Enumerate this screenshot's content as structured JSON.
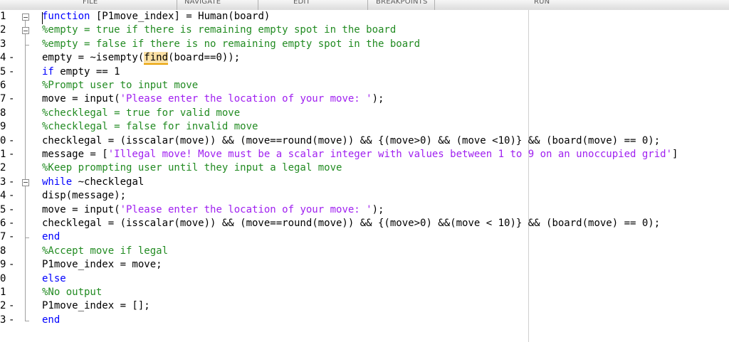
{
  "toolbar": {
    "sections": [
      "FILE",
      "NAVIGATE",
      "EDIT",
      "BREAKPOINTS",
      "RUN"
    ]
  },
  "editor": {
    "lines": [
      {
        "num": "1",
        "mark": "",
        "segs": [
          {
            "t": "function",
            "c": "kw"
          },
          {
            "t": " [P1move_index] = Human(board)",
            "c": ""
          }
        ]
      },
      {
        "num": "2",
        "mark": "",
        "segs": [
          {
            "t": "%empty = true if there is remaining empty spot in the board",
            "c": "cm"
          }
        ]
      },
      {
        "num": "3",
        "mark": "",
        "segs": [
          {
            "t": "%empty = false if there is no remaining empty spot in the board",
            "c": "cm"
          }
        ]
      },
      {
        "num": "4",
        "mark": "-",
        "segs": [
          {
            "t": "empty = ~isempty(",
            "c": ""
          },
          {
            "t": "find",
            "c": "hl"
          },
          {
            "t": "(board==0));",
            "c": ""
          }
        ]
      },
      {
        "num": "5",
        "mark": "-",
        "segs": [
          {
            "t": "if",
            "c": "kw"
          },
          {
            "t": " empty == 1",
            "c": ""
          }
        ]
      },
      {
        "num": "6",
        "mark": "",
        "segs": [
          {
            "t": "%Prompt user to input move",
            "c": "cm"
          }
        ]
      },
      {
        "num": "7",
        "mark": "-",
        "segs": [
          {
            "t": "move = input(",
            "c": ""
          },
          {
            "t": "'Please enter the location of your move: '",
            "c": "str"
          },
          {
            "t": ");",
            "c": ""
          }
        ]
      },
      {
        "num": "8",
        "mark": "",
        "segs": [
          {
            "t": "%checklegal = true for valid move",
            "c": "cm"
          }
        ]
      },
      {
        "num": "9",
        "mark": "",
        "segs": [
          {
            "t": "%checklegal = false for invalid move",
            "c": "cm"
          }
        ]
      },
      {
        "num": "0",
        "mark": "-",
        "segs": [
          {
            "t": "checklegal = (isscalar(move)) && (move==round(move)) && {(move>0) && (move <10)} && (board(move) == 0);",
            "c": ""
          }
        ]
      },
      {
        "num": "1",
        "mark": "-",
        "segs": [
          {
            "t": "message = [",
            "c": ""
          },
          {
            "t": "'Illegal move! Move must be a scalar integer with values between 1 to 9 on an unoccupied grid'",
            "c": "str"
          },
          {
            "t": "]",
            "c": ""
          }
        ]
      },
      {
        "num": "2",
        "mark": "",
        "segs": [
          {
            "t": "%Keep prompting user until they input a legal move",
            "c": "cm"
          }
        ]
      },
      {
        "num": "3",
        "mark": "-",
        "segs": [
          {
            "t": "while",
            "c": "kw"
          },
          {
            "t": " ~checklegal",
            "c": ""
          }
        ]
      },
      {
        "num": "4",
        "mark": "-",
        "segs": [
          {
            "t": "disp(message);",
            "c": ""
          }
        ]
      },
      {
        "num": "5",
        "mark": "-",
        "segs": [
          {
            "t": "move = input(",
            "c": ""
          },
          {
            "t": "'Please enter the location of your move: '",
            "c": "str"
          },
          {
            "t": ");",
            "c": ""
          }
        ]
      },
      {
        "num": "6",
        "mark": "-",
        "segs": [
          {
            "t": "checklegal = (isscalar(move)) && (move==round(move)) && {(move>0) &&(move < 10)} && (board(move) == 0);",
            "c": ""
          }
        ]
      },
      {
        "num": "7",
        "mark": "-",
        "segs": [
          {
            "t": "end",
            "c": "kw"
          }
        ]
      },
      {
        "num": "8",
        "mark": "",
        "segs": [
          {
            "t": "%Accept move if legal",
            "c": "cm"
          }
        ]
      },
      {
        "num": "9",
        "mark": "-",
        "segs": [
          {
            "t": "P1move_index = move;",
            "c": ""
          }
        ]
      },
      {
        "num": "0",
        "mark": "",
        "segs": [
          {
            "t": "else",
            "c": "kw"
          }
        ]
      },
      {
        "num": "1",
        "mark": "",
        "segs": [
          {
            "t": "%No output",
            "c": "cm"
          }
        ]
      },
      {
        "num": "2",
        "mark": "-",
        "segs": [
          {
            "t": "P1move_index = [];",
            "c": ""
          }
        ]
      },
      {
        "num": "3",
        "mark": "-",
        "segs": [
          {
            "t": "end",
            "c": "kw"
          }
        ]
      }
    ]
  }
}
